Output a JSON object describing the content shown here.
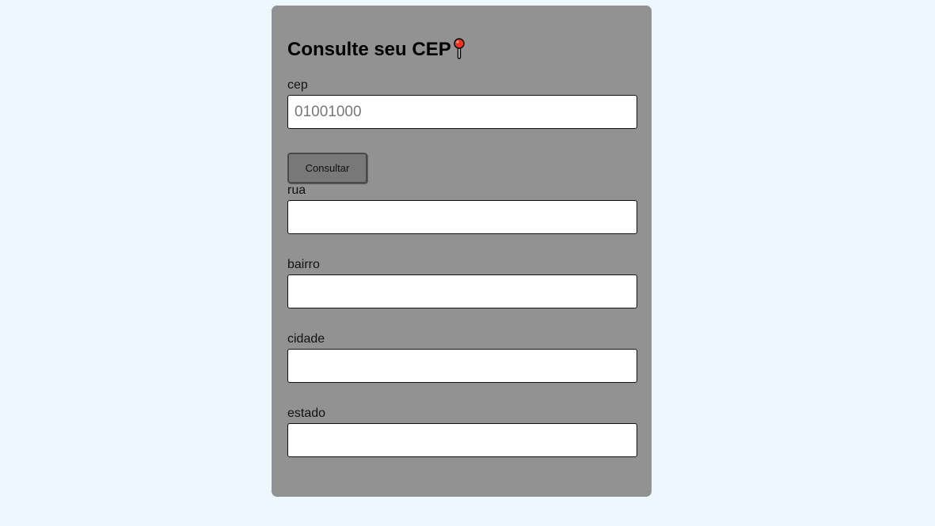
{
  "form": {
    "title": "Consulte seu CEP",
    "title_icon": "round-pushpin-icon",
    "cep": {
      "label": "cep",
      "value": "",
      "placeholder": "01001000"
    },
    "button_label": "Consultar",
    "rua": {
      "label": "rua",
      "value": ""
    },
    "bairro": {
      "label": "bairro",
      "value": ""
    },
    "cidade": {
      "label": "cidade",
      "value": ""
    },
    "estado": {
      "label": "estado",
      "value": ""
    }
  },
  "colors": {
    "page_background": "#eef6ff",
    "card_background": "#929292",
    "button_background": "#787878",
    "pin_red": "#e8351e"
  }
}
